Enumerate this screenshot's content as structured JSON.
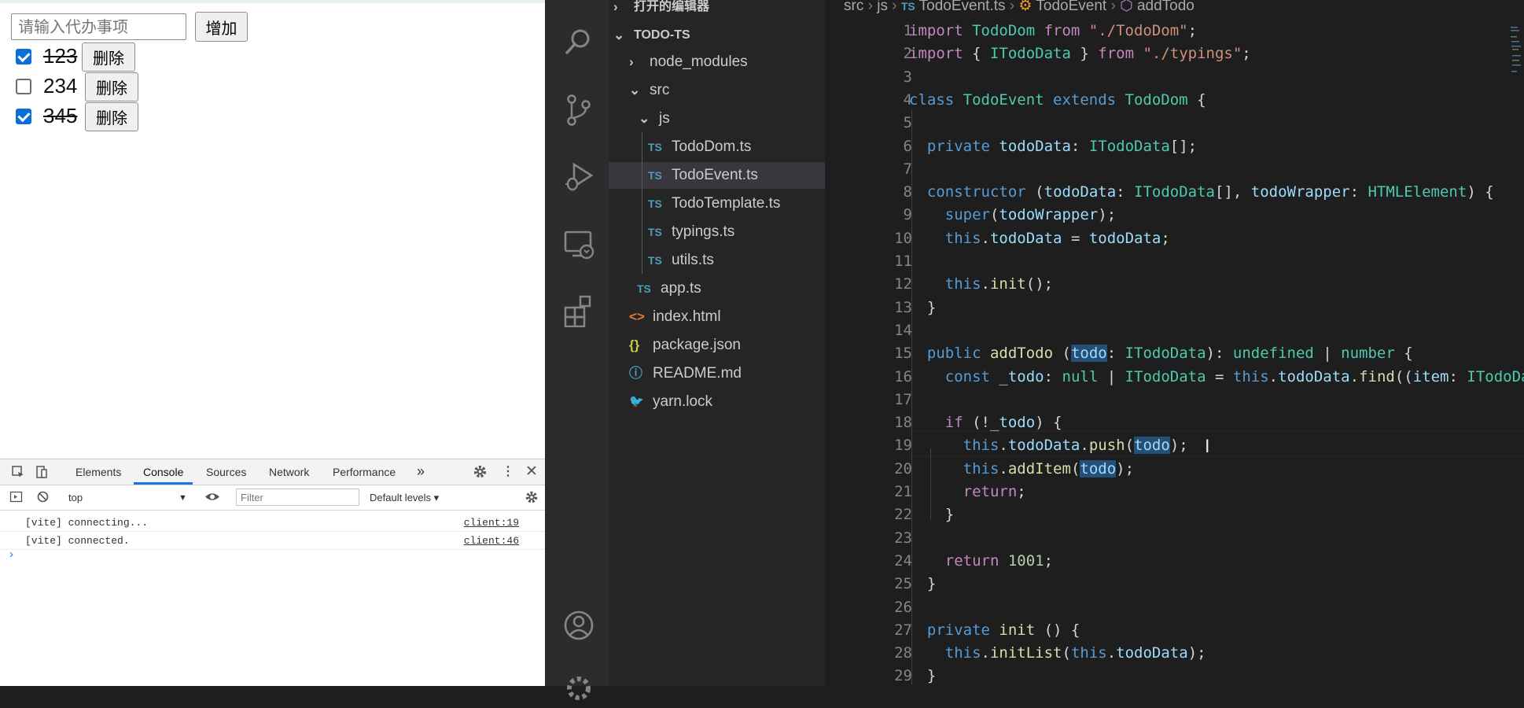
{
  "browser": {
    "input_placeholder": "请输入代办事项",
    "add_button": "增加",
    "todos": [
      {
        "text": "123",
        "completed": true,
        "delete_label": "删除"
      },
      {
        "text": "234",
        "completed": false,
        "delete_label": "删除"
      },
      {
        "text": "345",
        "completed": true,
        "delete_label": "删除"
      }
    ]
  },
  "devtools": {
    "tabs": [
      "Elements",
      "Console",
      "Sources",
      "Network",
      "Performance"
    ],
    "active_tab": "Console",
    "more_tabs": "»",
    "context": "top",
    "filter_placeholder": "Filter",
    "levels": "Default levels ▾",
    "logs": [
      {
        "message": "[vite] connecting...",
        "source": "client:19"
      },
      {
        "message": "[vite] connected.",
        "source": "client:46"
      }
    ],
    "prompt": "›"
  },
  "explorer": {
    "open_editors": "打开的编辑器",
    "project": "TODO-TS",
    "items": [
      {
        "label": "node_modules",
        "type": "folder",
        "badge": "›"
      },
      {
        "label": "src",
        "type": "folder-open",
        "badge": "⌄"
      },
      {
        "label": "js",
        "type": "folder-open",
        "badge": "⌄"
      },
      {
        "label": "TodoDom.ts",
        "type": "ts",
        "badge": "TS"
      },
      {
        "label": "TodoEvent.ts",
        "type": "ts",
        "badge": "TS",
        "selected": true
      },
      {
        "label": "TodoTemplate.ts",
        "type": "ts",
        "badge": "TS"
      },
      {
        "label": "typings.ts",
        "type": "ts",
        "badge": "TS"
      },
      {
        "label": "utils.ts",
        "type": "ts",
        "badge": "TS"
      },
      {
        "label": "app.ts",
        "type": "ts",
        "badge": "TS"
      },
      {
        "label": "index.html",
        "type": "html",
        "badge": "<>"
      },
      {
        "label": "package.json",
        "type": "json",
        "badge": "{}"
      },
      {
        "label": "README.md",
        "type": "md",
        "badge": "ⓘ"
      },
      {
        "label": "yarn.lock",
        "type": "lock",
        "badge": "🐦"
      }
    ]
  },
  "editor": {
    "breadcrumb": [
      "src",
      "js",
      "TodoEvent.ts",
      "TodoEvent",
      "addTodo"
    ],
    "breadcrumb_badge": "TS",
    "lines": [
      {
        "n": "1",
        "tokens": [
          [
            "kw2",
            "import "
          ],
          [
            "ty",
            "TodoDom "
          ],
          [
            "kw2",
            "from "
          ],
          [
            "st",
            "\"./TodoDom\""
          ],
          [
            "pu",
            ";"
          ]
        ]
      },
      {
        "n": "2",
        "tokens": [
          [
            "kw2",
            "import "
          ],
          [
            "pu",
            "{ "
          ],
          [
            "ty",
            "ITodoData"
          ],
          [
            "pu",
            " } "
          ],
          [
            "kw2",
            "from "
          ],
          [
            "st",
            "\"./typings\""
          ],
          [
            "pu",
            ";"
          ]
        ]
      },
      {
        "n": "3",
        "tokens": []
      },
      {
        "n": "4",
        "tokens": [
          [
            "kw",
            "class "
          ],
          [
            "ty",
            "TodoEvent "
          ],
          [
            "kw",
            "extends "
          ],
          [
            "ty",
            "TodoDom "
          ],
          [
            "pu",
            "{"
          ]
        ]
      },
      {
        "n": "5",
        "tokens": []
      },
      {
        "n": "6",
        "tokens": [
          [
            "pu",
            "  "
          ],
          [
            "kw",
            "private "
          ],
          [
            "vr",
            "todoData"
          ],
          [
            "pu",
            ": "
          ],
          [
            "ty",
            "ITodoData"
          ],
          [
            "pu",
            "[];"
          ]
        ]
      },
      {
        "n": "7",
        "tokens": []
      },
      {
        "n": "8",
        "tokens": [
          [
            "pu",
            "  "
          ],
          [
            "kw",
            "constructor "
          ],
          [
            "pu",
            "("
          ],
          [
            "vr",
            "todoData"
          ],
          [
            "pu",
            ": "
          ],
          [
            "ty",
            "ITodoData"
          ],
          [
            "pu",
            "[], "
          ],
          [
            "vr",
            "todoWrapper"
          ],
          [
            "pu",
            ": "
          ],
          [
            "ty",
            "HTMLElement"
          ],
          [
            "pu",
            ") {"
          ]
        ]
      },
      {
        "n": "9",
        "tokens": [
          [
            "pu",
            "    "
          ],
          [
            "kw",
            "super"
          ],
          [
            "pu",
            "("
          ],
          [
            "vr",
            "todoWrapper"
          ],
          [
            "pu",
            ");"
          ]
        ]
      },
      {
        "n": "10",
        "tokens": [
          [
            "pu",
            "    "
          ],
          [
            "kw",
            "this"
          ],
          [
            "pu",
            "."
          ],
          [
            "vr",
            "todoData"
          ],
          [
            "pu",
            " = "
          ],
          [
            "vr",
            "todoData"
          ],
          [
            "pu",
            ";"
          ]
        ]
      },
      {
        "n": "11",
        "tokens": []
      },
      {
        "n": "12",
        "tokens": [
          [
            "pu",
            "    "
          ],
          [
            "kw",
            "this"
          ],
          [
            "pu",
            "."
          ],
          [
            "fn",
            "init"
          ],
          [
            "pu",
            "();"
          ]
        ]
      },
      {
        "n": "13",
        "tokens": [
          [
            "pu",
            "  }"
          ]
        ]
      },
      {
        "n": "14",
        "tokens": []
      },
      {
        "n": "15",
        "tokens": [
          [
            "pu",
            "  "
          ],
          [
            "kw",
            "public "
          ],
          [
            "fn",
            "addTodo "
          ],
          [
            "pu",
            "("
          ],
          [
            "vrh",
            "todo"
          ],
          [
            "pu",
            ": "
          ],
          [
            "ty",
            "ITodoData"
          ],
          [
            "pu",
            "): "
          ],
          [
            "ty",
            "undefined"
          ],
          [
            "pu",
            " | "
          ],
          [
            "ty",
            "number"
          ],
          [
            "pu",
            " {"
          ]
        ]
      },
      {
        "n": "16",
        "tokens": [
          [
            "pu",
            "    "
          ],
          [
            "kw",
            "const "
          ],
          [
            "vr",
            "_todo"
          ],
          [
            "pu",
            ": "
          ],
          [
            "ty",
            "null"
          ],
          [
            "pu",
            " | "
          ],
          [
            "ty",
            "ITodoData"
          ],
          [
            "pu",
            " = "
          ],
          [
            "kw",
            "this"
          ],
          [
            "pu",
            "."
          ],
          [
            "vr",
            "todoData"
          ],
          [
            "pu",
            "."
          ],
          [
            "fn",
            "find"
          ],
          [
            "pu",
            "(("
          ],
          [
            "vr",
            "item"
          ],
          [
            "pu",
            ": "
          ],
          [
            "ty",
            "ITodoData"
          ]
        ]
      },
      {
        "n": "17",
        "tokens": []
      },
      {
        "n": "18",
        "tokens": [
          [
            "pu",
            "    "
          ],
          [
            "kw2",
            "if "
          ],
          [
            "pu",
            "(!"
          ],
          [
            "vr",
            "_todo"
          ],
          [
            "pu",
            ") {"
          ]
        ]
      },
      {
        "n": "19",
        "tokens": [
          [
            "pu",
            "      "
          ],
          [
            "kw",
            "this"
          ],
          [
            "pu",
            "."
          ],
          [
            "vr",
            "todoData"
          ],
          [
            "pu",
            "."
          ],
          [
            "fn",
            "push"
          ],
          [
            "pu",
            "("
          ],
          [
            "vrh",
            "todo"
          ],
          [
            "pu",
            ");"
          ]
        ]
      },
      {
        "n": "20",
        "tokens": [
          [
            "pu",
            "      "
          ],
          [
            "kw",
            "this"
          ],
          [
            "pu",
            "."
          ],
          [
            "fn",
            "addItem"
          ],
          [
            "pu",
            "("
          ],
          [
            "vrh",
            "todo"
          ],
          [
            "pu",
            ");"
          ]
        ]
      },
      {
        "n": "21",
        "tokens": [
          [
            "pu",
            "      "
          ],
          [
            "kw2",
            "return"
          ],
          [
            "pu",
            ";"
          ]
        ]
      },
      {
        "n": "22",
        "tokens": [
          [
            "pu",
            "    }"
          ]
        ]
      },
      {
        "n": "23",
        "tokens": []
      },
      {
        "n": "24",
        "tokens": [
          [
            "pu",
            "    "
          ],
          [
            "kw2",
            "return "
          ],
          [
            "nm",
            "1001"
          ],
          [
            "pu",
            ";"
          ]
        ]
      },
      {
        "n": "25",
        "tokens": [
          [
            "pu",
            "  }"
          ]
        ]
      },
      {
        "n": "26",
        "tokens": []
      },
      {
        "n": "27",
        "tokens": [
          [
            "pu",
            "  "
          ],
          [
            "kw",
            "private "
          ],
          [
            "fn",
            "init "
          ],
          [
            "pu",
            "() {"
          ]
        ]
      },
      {
        "n": "28",
        "tokens": [
          [
            "pu",
            "    "
          ],
          [
            "kw",
            "this"
          ],
          [
            "pu",
            "."
          ],
          [
            "fn",
            "initList"
          ],
          [
            "pu",
            "("
          ],
          [
            "kw",
            "this"
          ],
          [
            "pu",
            "."
          ],
          [
            "vr",
            "todoData"
          ],
          [
            "pu",
            ");"
          ]
        ]
      },
      {
        "n": "29",
        "tokens": [
          [
            "pu",
            "  }"
          ]
        ]
      }
    ]
  },
  "colors": {
    "editor_bg": "#1e1e1e",
    "sidebar_bg": "#252526",
    "activity_bg": "#2c2c2c",
    "checkbox_accent": "#0a6fd9",
    "devtools_active": "#1a73e8"
  }
}
